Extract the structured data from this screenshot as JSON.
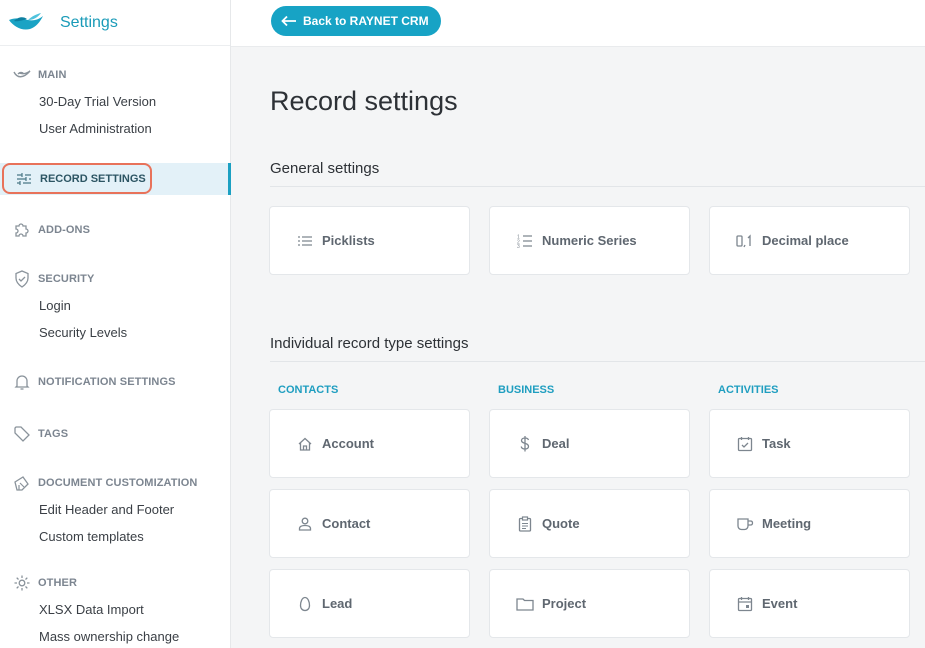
{
  "brand": {
    "title": "Settings"
  },
  "topbar": {
    "back_label": "Back to RAYNET CRM"
  },
  "page": {
    "title": "Record settings"
  },
  "sidebar": {
    "main": {
      "label": "MAIN",
      "items": [
        "30-Day Trial Version",
        "User Administration"
      ]
    },
    "record_settings": {
      "label": "RECORD SETTINGS"
    },
    "addons": {
      "label": "ADD-ONS"
    },
    "security": {
      "label": "SECURITY",
      "items": [
        "Login",
        "Security Levels"
      ]
    },
    "notifications": {
      "label": "NOTIFICATION SETTINGS"
    },
    "tags": {
      "label": "TAGS"
    },
    "document": {
      "label": "DOCUMENT CUSTOMIZATION",
      "items": [
        "Edit Header and Footer",
        "Custom templates"
      ]
    },
    "other": {
      "label": "OTHER",
      "items": [
        "XLSX Data Import",
        "Mass ownership change"
      ]
    }
  },
  "general": {
    "title": "General settings",
    "cards": [
      {
        "label": "Picklists",
        "icon": "list-icon"
      },
      {
        "label": "Numeric Series",
        "icon": "numbered-list-icon"
      },
      {
        "label": "Decimal place",
        "icon": "decimal-icon"
      }
    ]
  },
  "individual": {
    "title": "Individual record type settings",
    "columns": {
      "contacts": {
        "label": "CONTACTS",
        "cards": [
          {
            "label": "Account",
            "icon": "home-icon"
          },
          {
            "label": "Contact",
            "icon": "person-icon"
          },
          {
            "label": "Lead",
            "icon": "egg-icon"
          }
        ]
      },
      "business": {
        "label": "BUSINESS",
        "cards": [
          {
            "label": "Deal",
            "icon": "dollar-icon"
          },
          {
            "label": "Quote",
            "icon": "clipboard-icon"
          },
          {
            "label": "Project",
            "icon": "folder-icon"
          }
        ]
      },
      "activities": {
        "label": "ACTIVITIES",
        "cards": [
          {
            "label": "Task",
            "icon": "task-check-icon"
          },
          {
            "label": "Meeting",
            "icon": "cup-icon"
          },
          {
            "label": "Event",
            "icon": "calendar-icon"
          }
        ]
      }
    }
  },
  "colors": {
    "accent": "#17a3c5",
    "highlight": "#e8725a",
    "active_bg": "#e3f1f8"
  }
}
